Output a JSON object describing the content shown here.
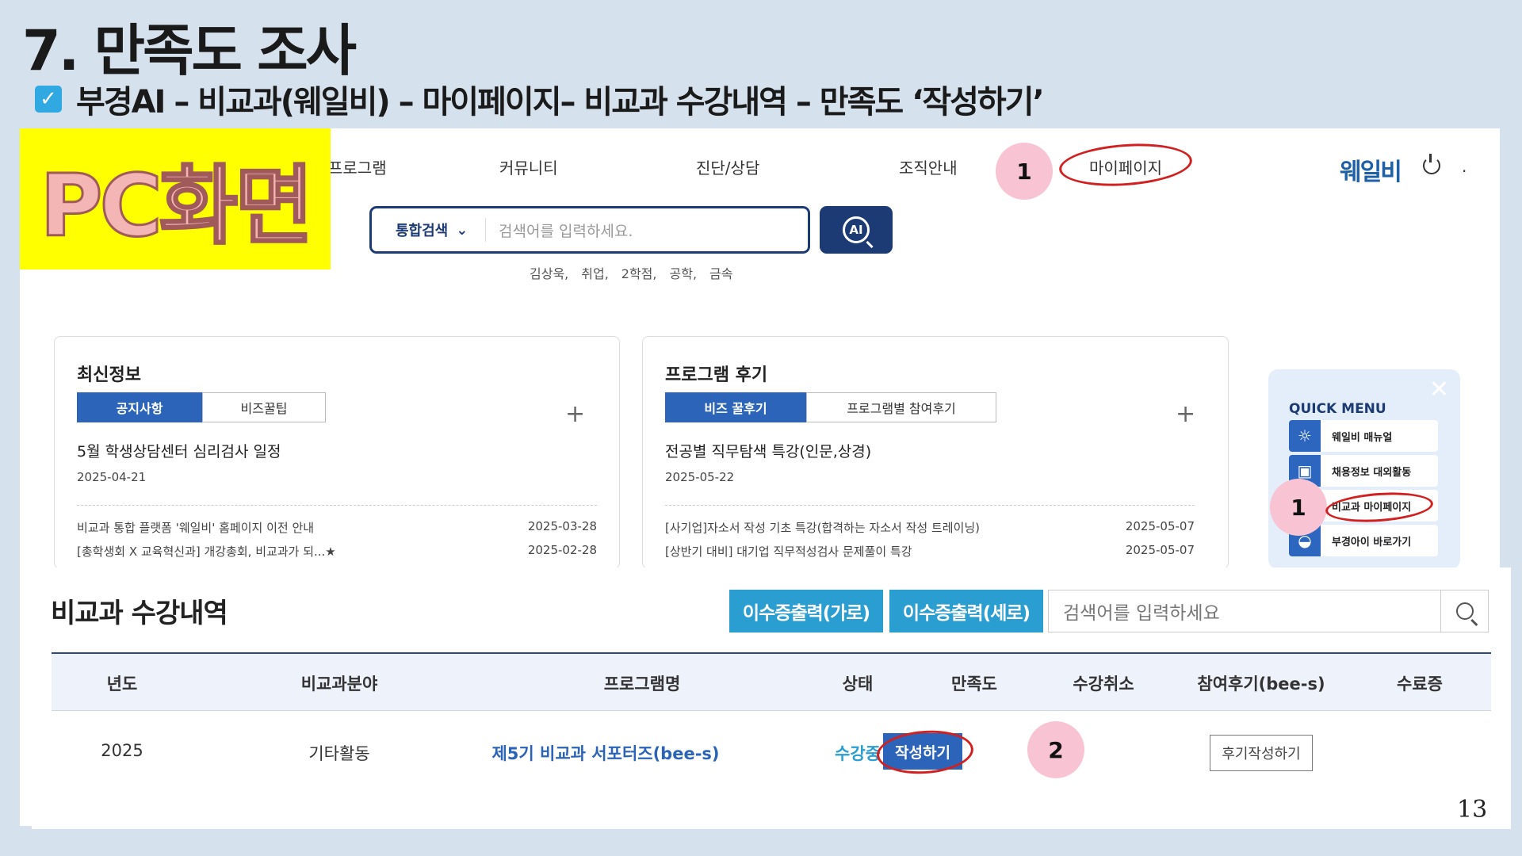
{
  "slide": {
    "title": "7. 만족도 조사",
    "subtitle": "부경AI – 비교과(웨일비) – 마이페이지– 비교과 수강내역 – 만족도 ‘작성하기’",
    "page_number": "13",
    "pc_label": "PC화면"
  },
  "header": {
    "nav": [
      "프로그램",
      "커뮤니티",
      "진단/상담",
      "조직안내",
      "마이페이지"
    ],
    "logo": "웨일비",
    "dot": "·"
  },
  "search": {
    "scope": "통합검색",
    "placeholder": "검색어를 입력하세요.",
    "ai_label": "AI",
    "keywords": [
      "김상욱,",
      "취업,",
      "2학점,",
      "공학,",
      "금속"
    ]
  },
  "badges": {
    "step1": "1",
    "step2": "2"
  },
  "news": {
    "title": "최신정보",
    "tabs": [
      "공지사항",
      "비즈꿀팁"
    ],
    "plus": "+",
    "headline": "5월 학생상담센터 심리검사 일정",
    "headline_date": "2025-04-21",
    "rows": [
      {
        "text": "비교과 통합 플랫폼 '웨일비' 홈페이지 이전 안내",
        "date": "2025-03-28"
      },
      {
        "text": "[총학생회 X 교육혁신과] 개강총회, 비교과가 되...★",
        "date": "2025-02-28"
      }
    ]
  },
  "reviews": {
    "title": "프로그램 후기",
    "tabs": [
      "비즈 꿀후기",
      "프로그램별 참여후기"
    ],
    "plus": "+",
    "headline": "전공별 직무탐색 특강(인문,상경)",
    "headline_date": "2025-05-22",
    "rows": [
      {
        "text": "[사기업]자소서 작성 기초 특강(합격하는 자소서 작성 트레이닝)",
        "date": "2025-05-07"
      },
      {
        "text": "[상반기 대비] 대기업 직무적성검사 문제풀이 특강",
        "date": "2025-05-07"
      }
    ]
  },
  "quick_menu": {
    "title": "QUICK MENU",
    "close": "✕",
    "items": [
      {
        "label": "웨일비 매뉴얼",
        "icon": "☼"
      },
      {
        "label": "채용정보 대외활동",
        "icon": "▣"
      },
      {
        "label": "비교과 마이페이지",
        "icon": "●"
      },
      {
        "label": "부경아이 바로가기",
        "icon": "◒"
      }
    ]
  },
  "records": {
    "title": "비교과 수강내역",
    "buttons": [
      "이수증출력(가로)",
      "이수증출력(세로)"
    ],
    "search_placeholder": "검색어를 입력하세요",
    "columns": [
      "년도",
      "비교과분야",
      "프로그램명",
      "상태",
      "만족도",
      "수강취소",
      "참여후기(bee-s)",
      "수료증"
    ],
    "row": {
      "year": "2025",
      "field": "기타활동",
      "program": "제5기 비교과 서포터즈(bee-s)",
      "status": "수강중",
      "satisfaction_btn": "작성하기",
      "review_btn": "후기작성하기"
    }
  }
}
